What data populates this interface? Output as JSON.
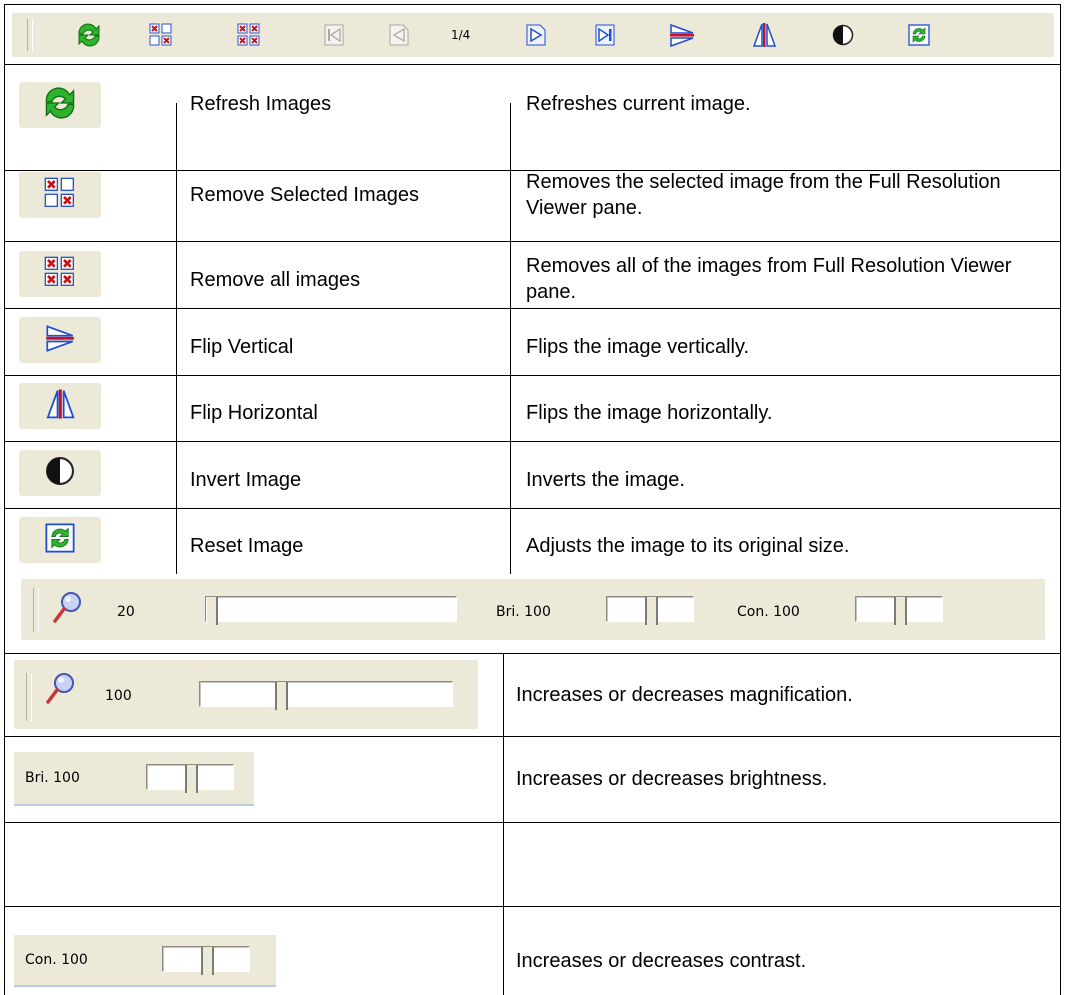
{
  "toolbar": {
    "page_indicator": "1/4",
    "icons": [
      "refresh-icon",
      "remove-selected-icon",
      "remove-all-icon",
      "first-page-icon",
      "previous-page-icon",
      "next-page-icon",
      "last-page-icon",
      "flip-vertical-icon",
      "flip-horizontal-icon",
      "invert-icon",
      "reset-icon"
    ]
  },
  "rows": [
    {
      "icon": "refresh-icon",
      "name": "Refresh Images",
      "desc": "Refreshes current image."
    },
    {
      "icon": "remove-selected-icon",
      "name": "Remove Selected Images",
      "desc": "Removes the selected image from the Full Resolution Viewer pane."
    },
    {
      "icon": "remove-all-icon",
      "name": "Remove all images",
      "desc": "Removes all of the images from Full Resolution Viewer pane."
    },
    {
      "icon": "flip-vertical-icon",
      "name": "Flip Vertical",
      "desc": "Flips the image vertically."
    },
    {
      "icon": "flip-horizontal-icon",
      "name": "Flip Horizontal",
      "desc": "Flips the image horizontally."
    },
    {
      "icon": "invert-icon",
      "name": "Invert Image",
      "desc": "Inverts the image."
    },
    {
      "icon": "reset-icon",
      "name": "Reset Image",
      "desc": "Adjusts the image to its original size."
    }
  ],
  "adjust_bar": {
    "zoom_value": "20",
    "zoom_level": 0,
    "brightness_label": "Bri. 100",
    "contrast_label": "Con. 100"
  },
  "slider_rows": [
    {
      "label": "100",
      "desc": "Increases or decreases magnification."
    },
    {
      "label": "Bri. 100",
      "desc": "Increases or decreases brightness."
    },
    {
      "label": "Con. 100",
      "desc": "Increases or decreases contrast."
    }
  ],
  "colors": {
    "toolbar_bg": "#ece9d8",
    "icon_green": "#22a524",
    "icon_blue": "#1f4fd1",
    "icon_red": "#c8102e"
  }
}
